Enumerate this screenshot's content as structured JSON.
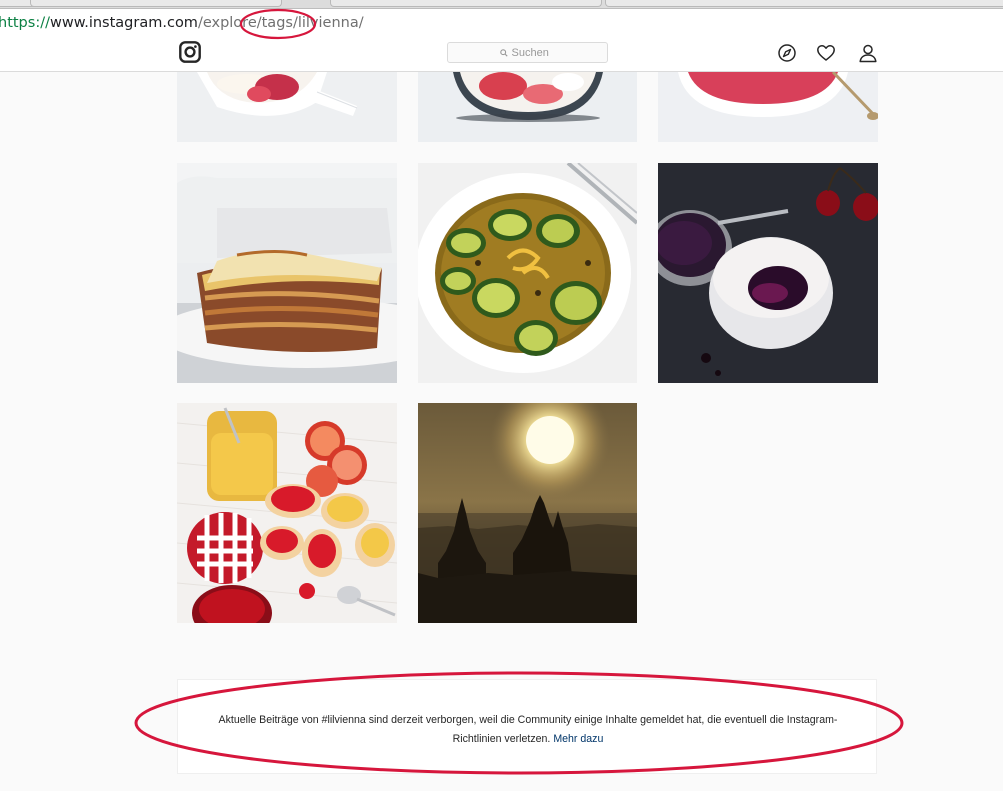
{
  "browser": {
    "url_scheme": "https://",
    "url_host": "www.instagram.com",
    "url_path": "/explore/tags/lilvienna/"
  },
  "header": {
    "logo_icon": "instagram-camera-icon",
    "search_placeholder": "Suchen",
    "search_icon": "magnifier-icon",
    "nav_icons": [
      "compass-icon",
      "heart-icon",
      "profile-icon"
    ]
  },
  "grid": {
    "posts": [
      {
        "name": "strawberry-bowl-post",
        "row": 1,
        "col": 1
      },
      {
        "name": "strawberry-yogurt-glass-post",
        "row": 1,
        "col": 2
      },
      {
        "name": "berry-smoothie-bowl-post",
        "row": 1,
        "col": 3
      },
      {
        "name": "lasagna-post",
        "row": 2,
        "col": 1
      },
      {
        "name": "pickled-zucchini-post",
        "row": 2,
        "col": 2
      },
      {
        "name": "yogurt-cherries-post",
        "row": 2,
        "col": 3
      },
      {
        "name": "lemon-curd-blood-orange-post",
        "row": 3,
        "col": 1
      },
      {
        "name": "bagan-temples-sunrise-post",
        "row": 3,
        "col": 2
      }
    ]
  },
  "notice": {
    "line1": "Aktuelle Beiträge von #lilvienna sind derzeit verborgen, weil die Community einige Inhalte gemeldet hat, die eventuell die Instagram-",
    "line2": "Richtlinien verletzen.",
    "link": "Mehr dazu"
  },
  "colors": {
    "annotation_red": "#d6163c",
    "link_blue": "#003569",
    "url_green": "#0b8043"
  }
}
